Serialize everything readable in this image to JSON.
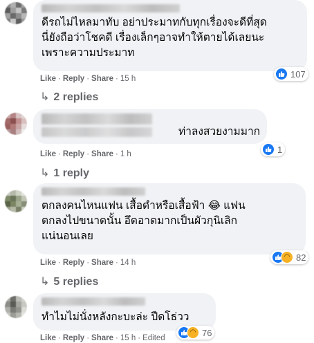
{
  "action_labels": {
    "like": "Like",
    "reply": "Reply",
    "share": "Share",
    "sep": "·"
  },
  "comments": [
    {
      "text": "ดีรถไม่ไหลมาทับ อย่าประมาทกับทุกเรื่องจะดีที่สุด\nนี่ยังถือว่าโชคดี เรื่องเล็กๆอาจทำให้ตายได้เลยนะ\nเพราะความประมาท",
      "time": "15 h",
      "reactions": {
        "types": [
          "like-icon"
        ],
        "count": "107"
      },
      "replies_label": "2 replies"
    },
    {
      "text": "ท่าลงสวยงามมาก",
      "time": "1 h",
      "reactions": {
        "types": [
          "like-icon"
        ],
        "count": "1"
      },
      "replies_label": "1 reply"
    },
    {
      "text": "ตกลงคนไหนแฟน เสื้อดำหรือเสื้อฟ้า 😂 แฟน\nตกลงไปขนาดนั้น อึดอาดมากเป็นผัวกุนิเลิก\nแน่นอนเลย",
      "time": "14 h",
      "reactions": {
        "types": [
          "like-icon",
          "haha-icon"
        ],
        "count": "82"
      },
      "replies_label": "5 replies"
    },
    {
      "text": "ทำไมไม่นั่งหลังกะบะล่ะ ปืดโธ่วว",
      "time": "15 h",
      "edited": "Edited",
      "reactions": {
        "types": [
          "like-icon",
          "haha-icon"
        ],
        "count": "76"
      }
    }
  ],
  "colors": {
    "like": "#1877f2",
    "haha": "#f7b125",
    "bubble": "#f0f2f5",
    "meta": "#65676b"
  }
}
